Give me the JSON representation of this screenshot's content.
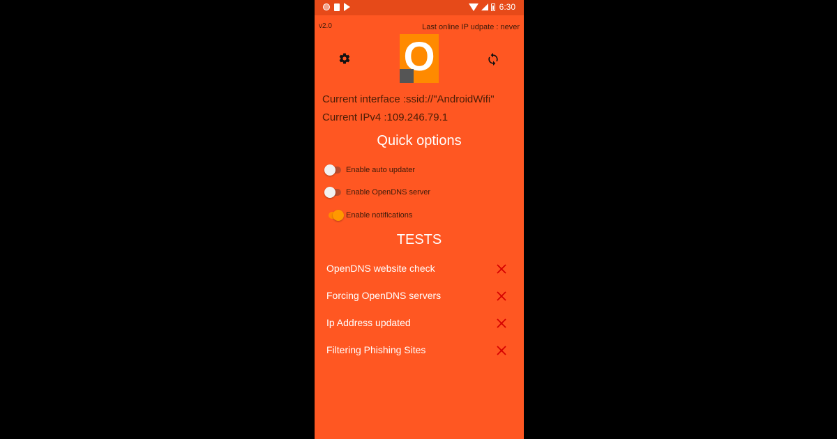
{
  "status_bar": {
    "time": "6:30"
  },
  "header": {
    "version": "v2.0",
    "last_update": "Last online IP udpate : never",
    "logo_letter": "O"
  },
  "info": {
    "interface": "Current interface :ssid://\"AndroidWifi\"",
    "ipv4": "Current IPv4 :109.246.79.1"
  },
  "quick_options": {
    "title": "Quick options",
    "items": [
      {
        "label": "Enable auto updater",
        "enabled": false
      },
      {
        "label": "Enable OpenDNS server",
        "enabled": false
      },
      {
        "label": "Enable notifications",
        "enabled": true
      }
    ]
  },
  "tests": {
    "title": "TESTS",
    "items": [
      {
        "label": "OpenDNS website check",
        "status": "failed"
      },
      {
        "label": "Forcing OpenDNS servers",
        "status": "failed"
      },
      {
        "label": "Ip Address updated",
        "status": "failed"
      },
      {
        "label": "Filtering Phishing Sites",
        "status": "failed"
      }
    ]
  },
  "colors": {
    "background": "#ff5722",
    "status_bar": "#e64a19",
    "fail": "#d50000",
    "toggle_on": "#ff9800"
  }
}
